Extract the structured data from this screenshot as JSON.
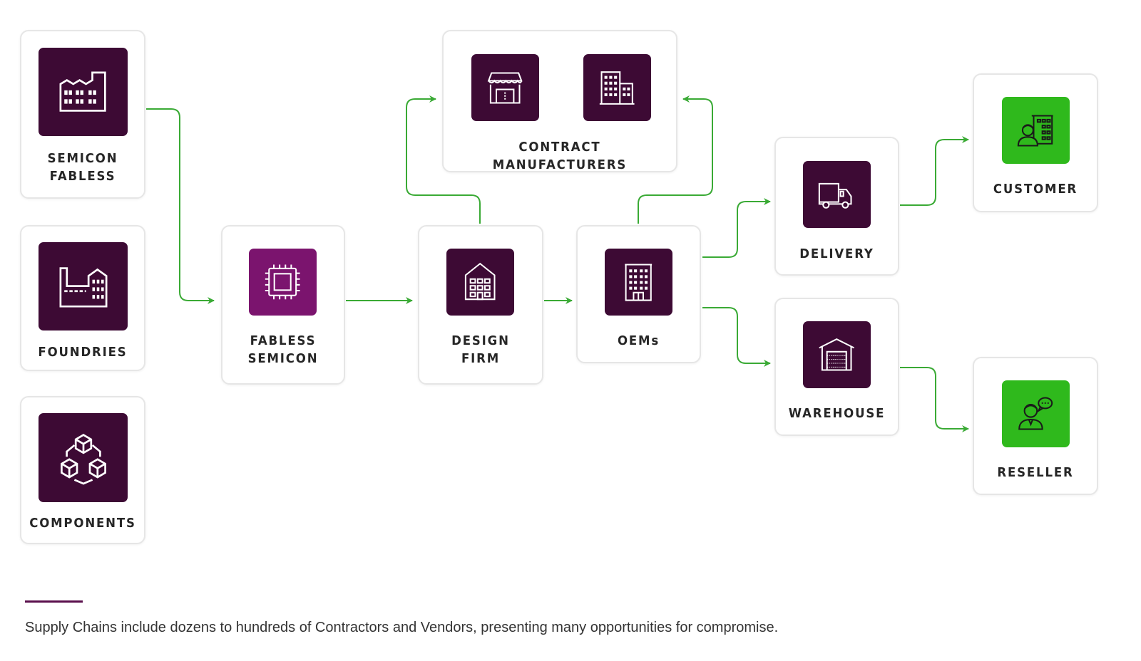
{
  "colors": {
    "primary_icon_bg": "#3d0a34",
    "accent_icon_bg": "#7b146e",
    "end_icon_bg": "#2fb91c",
    "connector": "#3aaa35"
  },
  "nodes": {
    "semicon_fabless": {
      "line1": "SEMICON",
      "line2": "FABLESS",
      "icon": "factory-icon"
    },
    "foundries": {
      "line1": "FOUNDRIES",
      "icon": "foundry-icon"
    },
    "components": {
      "line1": "COMPONENTS",
      "icon": "cubes-icon"
    },
    "fabless_semicon": {
      "line1": "FABLESS",
      "line2": "SEMICON",
      "icon": "chip-icon"
    },
    "design_firm": {
      "line1": "DESIGN",
      "line2": "FIRM",
      "icon": "house-building-icon"
    },
    "oems": {
      "line1": "OEMs",
      "icon": "office-building-icon"
    },
    "contract_manufacturers": {
      "line1": "CONTRACT MANUFACTURERS",
      "icons": [
        "storefront-icon",
        "city-buildings-icon"
      ]
    },
    "delivery": {
      "line1": "DELIVERY",
      "icon": "truck-icon"
    },
    "warehouse": {
      "line1": "WAREHOUSE",
      "icon": "warehouse-icon"
    },
    "customer": {
      "line1": "CUSTOMER",
      "icon": "person-building-icon"
    },
    "reseller": {
      "line1": "RESELLER",
      "icon": "person-chat-icon"
    }
  },
  "edges": [
    [
      "semicon_fabless",
      "fabless_semicon"
    ],
    [
      "fabless_semicon",
      "design_firm"
    ],
    [
      "design_firm",
      "contract_manufacturers"
    ],
    [
      "design_firm",
      "oems"
    ],
    [
      "oems",
      "contract_manufacturers"
    ],
    [
      "oems",
      "delivery"
    ],
    [
      "oems",
      "warehouse"
    ],
    [
      "delivery",
      "customer"
    ],
    [
      "warehouse",
      "reseller"
    ]
  ],
  "caption": "Supply Chains include dozens to hundreds of Contractors and Vendors, presenting many opportunities for compromise."
}
